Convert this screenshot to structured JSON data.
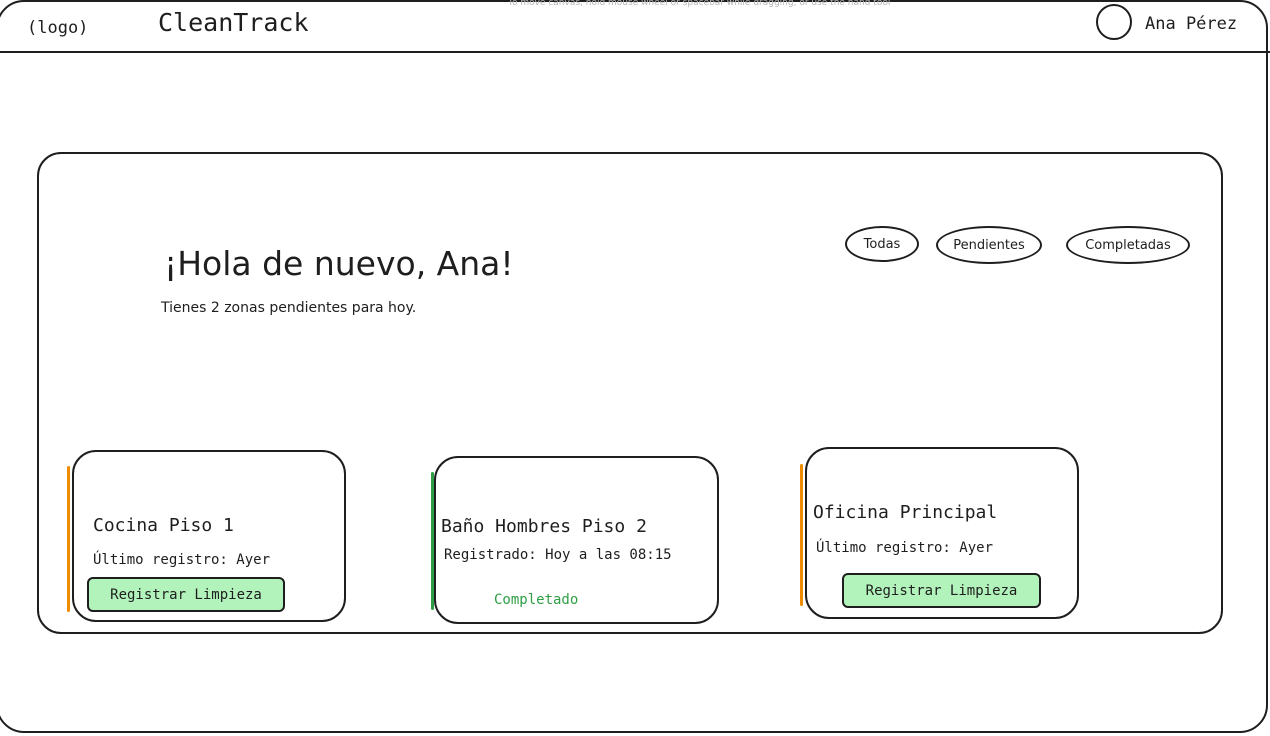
{
  "header": {
    "logo_text": "(logo)",
    "app_name": "CleanTrack",
    "canvas_hint": "To move canvas, hold mouse wheel or spacebar while dragging, or use the hand tool",
    "user_name": "Ana Pérez"
  },
  "main": {
    "greeting": "¡Hola de nuevo, Ana!",
    "subtitle": "Tienes 2 zonas pendientes para hoy.",
    "filters": [
      {
        "label": "Todas"
      },
      {
        "label": "Pendientes"
      },
      {
        "label": "Completadas"
      }
    ]
  },
  "zones": [
    {
      "title": "Cocina Piso 1",
      "info": "Último registro: Ayer",
      "action_label": "Registrar Limpieza",
      "accent_color": "#f08c00"
    },
    {
      "title": "Baño Hombres Piso 2",
      "info": "Registrado: Hoy a las 08:15",
      "status": "Completado",
      "accent_color": "#2f9e44"
    },
    {
      "title": "Oficina Principal",
      "info": "Último registro: Ayer",
      "action_label": "Registrar Limpieza",
      "accent_color": "#f08c00"
    }
  ],
  "colors": {
    "button_fill": "#b2f2bb",
    "completed_text": "#2f9e44",
    "pending_accent": "#f08c00",
    "stroke": "#1e1e1e"
  }
}
